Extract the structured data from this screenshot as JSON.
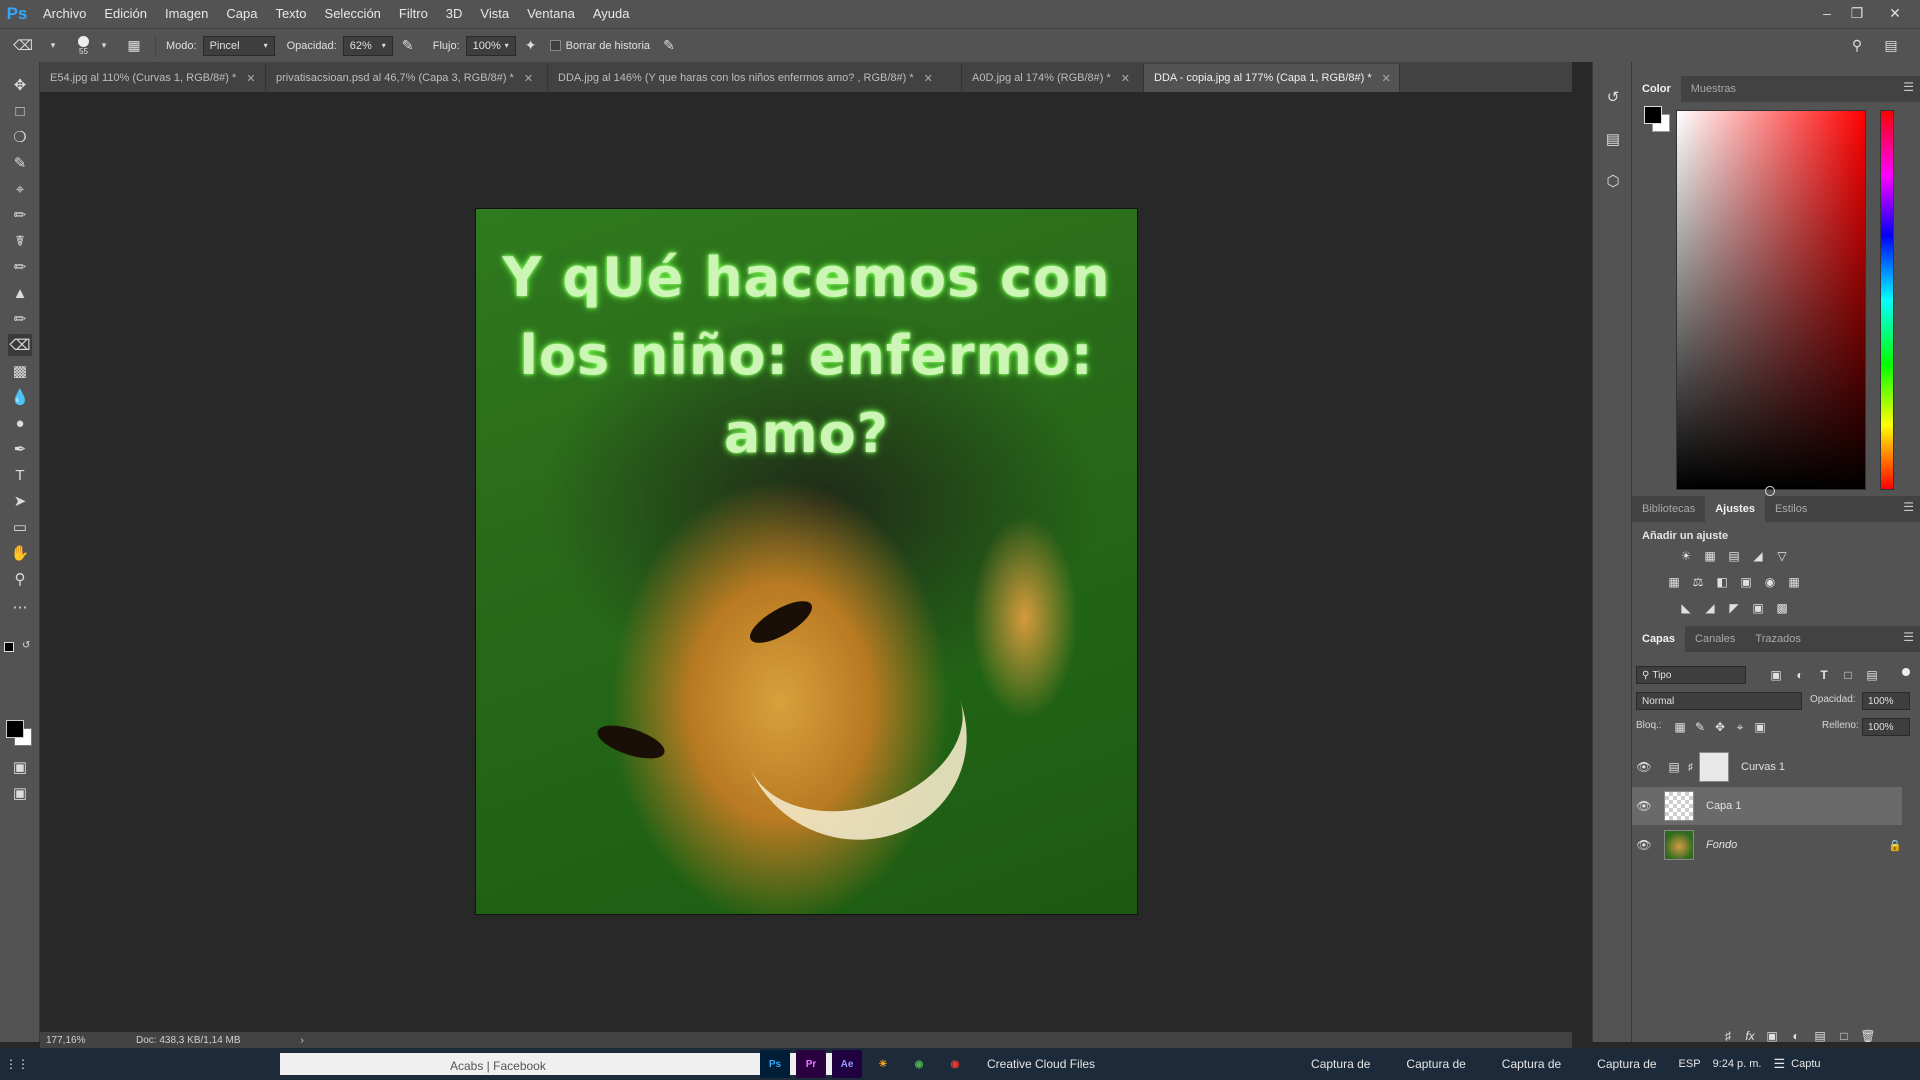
{
  "app": {
    "logo": "Ps"
  },
  "menu": [
    "Archivo",
    "Edición",
    "Imagen",
    "Capa",
    "Texto",
    "Selección",
    "Filtro",
    "3D",
    "Vista",
    "Ventana",
    "Ayuda"
  ],
  "options": {
    "brush_size": "55",
    "mode_label": "Modo:",
    "mode_value": "Pincel",
    "opacity_label": "Opacidad:",
    "opacity_value": "62%",
    "flow_label": "Flujo:",
    "flow_value": "100%",
    "history_label": "Borrar de historia"
  },
  "tabs": [
    "E54.jpg al 110% (Curvas 1, RGB/8#) *",
    "privatisacsioan.psd al 46,7% (Capa 3, RGB/8#) *",
    "DDA.jpg al 146% (Y que haras con los niños enfermos  amo?  , RGB/8#) *",
    "A0D.jpg al 174% (RGB/8#) *",
    "DDA - copia.jpg al 177% (Capa 1, RGB/8#) *"
  ],
  "artwork": {
    "text": "Y qUé hacemos con los niño: enfermo: amo?"
  },
  "color_panel": {
    "tabs": [
      "Color",
      "Muestras"
    ],
    "foreground": "#000000",
    "background": "#ffffff"
  },
  "adjust_panel": {
    "tabs": [
      "Bibliotecas",
      "Ajustes",
      "Estilos"
    ],
    "title": "Añadir un ajuste"
  },
  "layers_panel": {
    "tabs": [
      "Capas",
      "Canales",
      "Trazados"
    ],
    "filter": "Tipo",
    "blend_mode": "Normal",
    "opacity_label": "Opacidad:",
    "opacity_value": "100%",
    "lock_label": "Bloq.:",
    "fill_label": "Relleno:",
    "fill_value": "100%",
    "layers": [
      {
        "name": "Curvas 1"
      },
      {
        "name": "Capa 1"
      },
      {
        "name": "Fondo"
      }
    ]
  },
  "status": {
    "zoom": "177,16%",
    "doc": "Doc: 438,3 KB/1,14 MB"
  },
  "taskbar": {
    "browser_text": "Acabs | Facebook",
    "apps": [
      "Ps",
      "Pr",
      "Ae"
    ],
    "cc_files": "Creative Cloud Files",
    "captures": [
      "Captura de",
      "Captura de",
      "Captura de",
      "Captura de",
      "Captu"
    ],
    "lang": "ESP",
    "time": "9:24 p. m."
  }
}
